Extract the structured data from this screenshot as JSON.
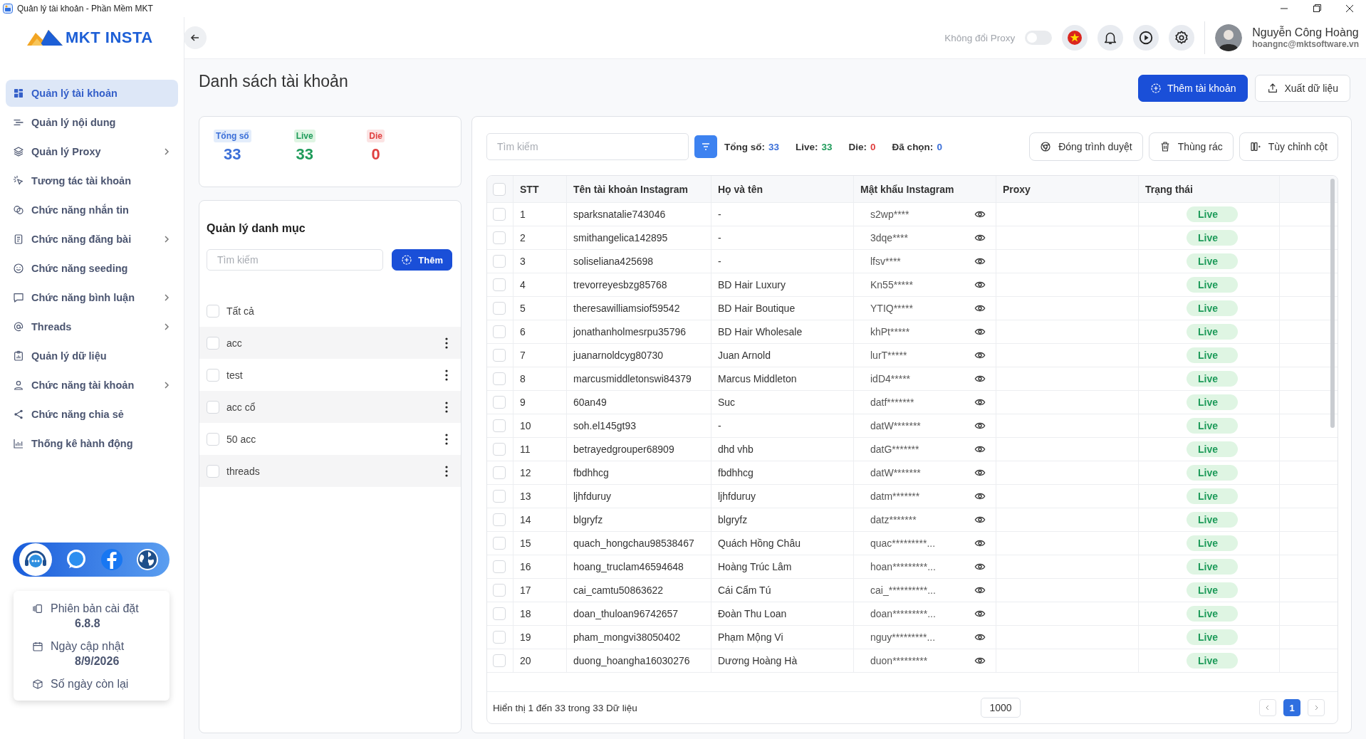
{
  "window": {
    "title": "Quản lý tài khoản - Phần Mềm MKT"
  },
  "sidebar": {
    "logo_text": "MKT INSTA",
    "items": [
      {
        "label": "Quản lý tài khoản",
        "selected": true,
        "has_submenu": false
      },
      {
        "label": "Quản lý nội dung",
        "selected": false,
        "has_submenu": false
      },
      {
        "label": "Quản lý Proxy",
        "selected": false,
        "has_submenu": true
      },
      {
        "label": "Tương tác tài khoản",
        "selected": false,
        "has_submenu": false
      },
      {
        "label": "Chức năng nhắn tin",
        "selected": false,
        "has_submenu": false
      },
      {
        "label": "Chức năng đăng bài",
        "selected": false,
        "has_submenu": true
      },
      {
        "label": "Chức năng seeding",
        "selected": false,
        "has_submenu": false
      },
      {
        "label": "Chức năng bình luận",
        "selected": false,
        "has_submenu": true
      },
      {
        "label": "Threads",
        "selected": false,
        "has_submenu": true
      },
      {
        "label": "Quản lý dữ liệu",
        "selected": false,
        "has_submenu": false
      },
      {
        "label": "Chức năng tài khoản",
        "selected": false,
        "has_submenu": true
      },
      {
        "label": "Chức năng chia sẻ",
        "selected": false,
        "has_submenu": false
      },
      {
        "label": "Thống kê hành động",
        "selected": false,
        "has_submenu": false
      }
    ],
    "info": [
      {
        "label": "Phiên bản cài đặt",
        "value": "6.8.8"
      },
      {
        "label": "Ngày cập nhật",
        "value": "8/9/2026"
      },
      {
        "label": "Số ngày còn lại"
      }
    ]
  },
  "header": {
    "proxy_toggle": {
      "label": "Không đổi Proxy",
      "on": false
    },
    "user": {
      "name": "Nguyễn Công Hoàng",
      "email": "hoangnc@mktsoftware.vn"
    }
  },
  "page_title": "Danh sách tài khoản",
  "page_actions": [
    {
      "label": "Thêm tài khoản",
      "kind": "primary"
    },
    {
      "label": "Xuất dữ liệu",
      "kind": "export"
    }
  ],
  "stats": [
    {
      "label": "Tổng số",
      "value": "33",
      "kind": "total"
    },
    {
      "label": "Live",
      "value": "33",
      "kind": "live"
    },
    {
      "label": "Die",
      "value": "0",
      "kind": "die"
    }
  ],
  "categories": {
    "title": "Quản lý danh mục",
    "search_placeholder": "Tìm kiếm",
    "add_label": "Thêm",
    "all": {
      "label": "Tất cả",
      "checked": false
    },
    "items": [
      {
        "label": "acc",
        "checked": false
      },
      {
        "label": "test",
        "checked": false
      },
      {
        "label": "acc cổ",
        "checked": false
      },
      {
        "label": "50 acc",
        "checked": false
      },
      {
        "label": "threads",
        "checked": false
      }
    ]
  },
  "toolbar": {
    "search_placeholder": "Tìm kiếm",
    "summary": [
      {
        "label": "Tổng số:",
        "value": "33",
        "kind": "total"
      },
      {
        "label": "Live:",
        "value": "33",
        "kind": "live"
      },
      {
        "label": "Die:",
        "value": "0",
        "kind": "die"
      },
      {
        "label": "Đã chọn:",
        "value": "0",
        "kind": "total"
      }
    ],
    "buttons": [
      {
        "label": "Đóng trình duyệt"
      },
      {
        "label": "Thùng rác"
      },
      {
        "label": "Tùy chỉnh cột"
      }
    ]
  },
  "table": {
    "select_all_checked": false,
    "columns": [
      "STT",
      "Tên tài khoản Instagram",
      "Họ và tên",
      "Mật khẩu Instagram",
      "Proxy",
      "Trạng thái"
    ],
    "rows": [
      {
        "checked": false,
        "stt": "1",
        "username": "sparksnatalie743046",
        "full_name": "-",
        "password": "s2wp****",
        "status": "Live"
      },
      {
        "checked": false,
        "stt": "2",
        "username": "smithangelica142895",
        "full_name": "-",
        "password": "3dqe****",
        "status": "Live"
      },
      {
        "checked": false,
        "stt": "3",
        "username": "soliseliana425698",
        "full_name": "-",
        "password": "lfsv****",
        "status": "Live"
      },
      {
        "checked": false,
        "stt": "4",
        "username": "trevorreyesbzg85768",
        "full_name": "BD Hair Luxury",
        "password": "Kn55*****",
        "status": "Live"
      },
      {
        "checked": false,
        "stt": "5",
        "username": "theresawilliamsiof59542",
        "full_name": "BD Hair Boutique",
        "password": "YTIQ*****",
        "status": "Live"
      },
      {
        "checked": false,
        "stt": "6",
        "username": "jonathanholmesrpu35796",
        "full_name": "BD Hair Wholesale",
        "password": "khPt*****",
        "status": "Live"
      },
      {
        "checked": false,
        "stt": "7",
        "username": "juanarnoldcyg80730",
        "full_name": "Juan Arnold",
        "password": "lurT*****",
        "status": "Live"
      },
      {
        "checked": false,
        "stt": "8",
        "username": "marcusmiddletonswi84379",
        "full_name": "Marcus Middleton",
        "password": "idD4*****",
        "status": "Live"
      },
      {
        "checked": false,
        "stt": "9",
        "username": "60an49",
        "full_name": "Suc",
        "password": "datf*******",
        "status": "Live"
      },
      {
        "checked": false,
        "stt": "10",
        "username": "soh.el145gt93",
        "full_name": "-",
        "password": "datW*******",
        "status": "Live"
      },
      {
        "checked": false,
        "stt": "11",
        "username": "betrayedgrouper68909",
        "full_name": "dhd vhb",
        "password": "datG*******",
        "status": "Live"
      },
      {
        "checked": false,
        "stt": "12",
        "username": "fbdhhcg",
        "full_name": "fbdhhcg",
        "password": "datW*******",
        "status": "Live"
      },
      {
        "checked": false,
        "stt": "13",
        "username": "ljhfduruy",
        "full_name": "ljhfduruy",
        "password": "datm*******",
        "status": "Live"
      },
      {
        "checked": false,
        "stt": "14",
        "username": "blgryfz",
        "full_name": "blgryfz",
        "password": "datz*******",
        "status": "Live"
      },
      {
        "checked": false,
        "stt": "15",
        "username": "quach_hongchau98538467",
        "full_name": "Quách Hồng Châu",
        "password": "quac*********...",
        "status": "Live"
      },
      {
        "checked": false,
        "stt": "16",
        "username": "hoang_truclam46594648",
        "full_name": "Hoàng Trúc Lâm",
        "password": "hoan*********...",
        "status": "Live"
      },
      {
        "checked": false,
        "stt": "17",
        "username": "cai_camtu50863622",
        "full_name": "Cái Cẩm Tú",
        "password": "cai_**********...",
        "status": "Live"
      },
      {
        "checked": false,
        "stt": "18",
        "username": "doan_thuloan96742657",
        "full_name": "Đoàn Thu Loan",
        "password": "doan*********...",
        "status": "Live"
      },
      {
        "checked": false,
        "stt": "19",
        "username": "pham_mongvi38050402",
        "full_name": "Phạm Mộng Vi",
        "password": "nguy*********...",
        "status": "Live"
      },
      {
        "checked": false,
        "stt": "20",
        "username": "duong_hoangha16030276",
        "full_name": "Dương Hoàng Hà",
        "password": "duon*********",
        "status": "Live"
      }
    ],
    "footer_text": "Hiển thị 1 đến 33 trong 33 Dữ liệu",
    "page_size": "1000",
    "pages": [
      {
        "label": "1",
        "selected": true
      }
    ]
  }
}
